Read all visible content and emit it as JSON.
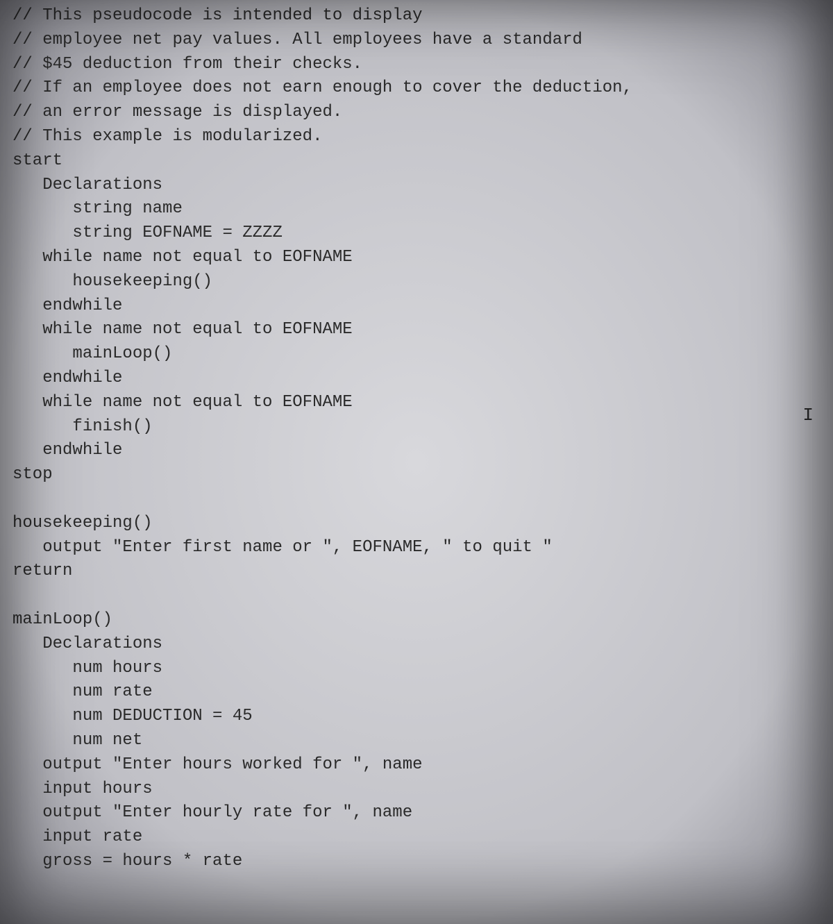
{
  "cursor_marker": "I",
  "code_lines": [
    "// This pseudocode is intended to display",
    "// employee net pay values. All employees have a standard",
    "// $45 deduction from their checks.",
    "// If an employee does not earn enough to cover the deduction,",
    "// an error message is displayed.",
    "// This example is modularized.",
    "start",
    "   Declarations",
    "      string name",
    "      string EOFNAME = ZZZZ",
    "   while name not equal to EOFNAME",
    "      housekeeping()",
    "   endwhile",
    "   while name not equal to EOFNAME",
    "      mainLoop()",
    "   endwhile",
    "   while name not equal to EOFNAME",
    "      finish()",
    "   endwhile",
    "stop",
    "",
    "housekeeping()",
    "   output \"Enter first name or \", EOFNAME, \" to quit \"",
    "return",
    "",
    "mainLoop()",
    "   Declarations",
    "      num hours",
    "      num rate",
    "      num DEDUCTION = 45",
    "      num net",
    "   output \"Enter hours worked for \", name",
    "   input hours",
    "   output \"Enter hourly rate for \", name",
    "   input rate",
    "   gross = hours * rate"
  ]
}
